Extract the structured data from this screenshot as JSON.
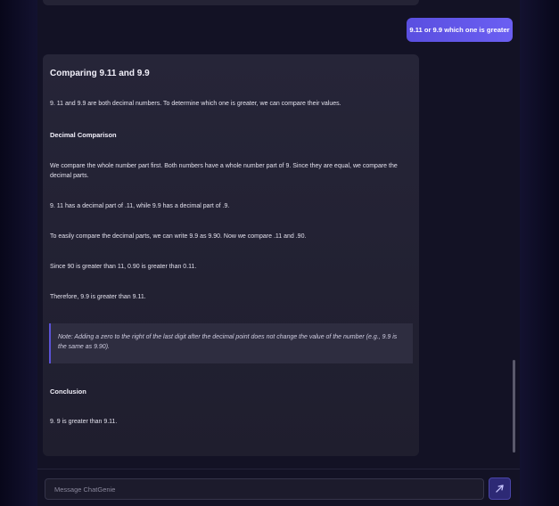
{
  "user_message": "9.11 or 9.9 which one is greater",
  "assistant": {
    "title": "Comparing 9.11 and 9.9",
    "intro": " 9. 11 and 9.9 are both decimal numbers. To determine which one is greater, we can compare their values.",
    "section1_heading": "Decimal Comparison",
    "para1": "We compare the whole number part first. Both numbers have a whole number part of 9. Since they are equal, we compare the decimal parts.",
    "para2": " 9. 11 has a decimal part of .11, while 9.9 has a decimal part of .9.",
    "para3": "To easily compare the decimal parts, we can write 9.9 as 9.90. Now we compare .11 and .90.",
    "para4": "Since 90 is greater than 11, 0.90 is greater than 0.11.",
    "para5": "Therefore, 9.9 is greater than 9.11.",
    "note": "Note: Adding a zero to the right of the last digit after the decimal point does not change the value of the number (e.g., 9.9 is the same as 9.90).",
    "section2_heading": "Conclusion",
    "conclusion": " 9. 9 is greater than 9.11."
  },
  "composer": {
    "placeholder": "Message ChatGenie",
    "send_icon": "send-icon"
  },
  "colors": {
    "background": "#0b0a1f",
    "accent": "#5a4fe0",
    "card": "#262538"
  }
}
